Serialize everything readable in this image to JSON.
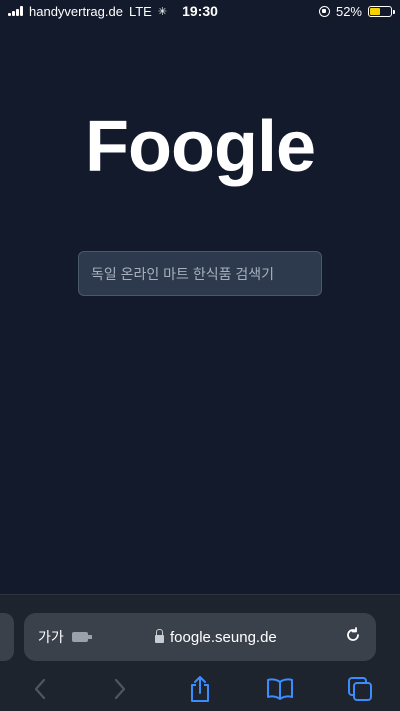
{
  "status_bar": {
    "carrier": "handyvertrag.de",
    "network": "LTE",
    "time": "19:30",
    "battery_percent": "52%",
    "battery_level": 0.52,
    "battery_color": "#f5d200"
  },
  "main": {
    "logo": "Foogle",
    "search": {
      "placeholder": "독일 온라인 마트 한식품 검색기",
      "value": ""
    }
  },
  "browser": {
    "aa_label": "가가",
    "url": "foogle.seung.de",
    "icons": {
      "back": "chevron-left-icon",
      "forward": "chevron-right-icon",
      "share": "share-icon",
      "bookmarks": "book-icon",
      "tabs": "tabs-icon",
      "reload": "reload-icon",
      "lock": "lock-icon",
      "extension": "extension-icon"
    },
    "accent": "#3a8cff"
  }
}
